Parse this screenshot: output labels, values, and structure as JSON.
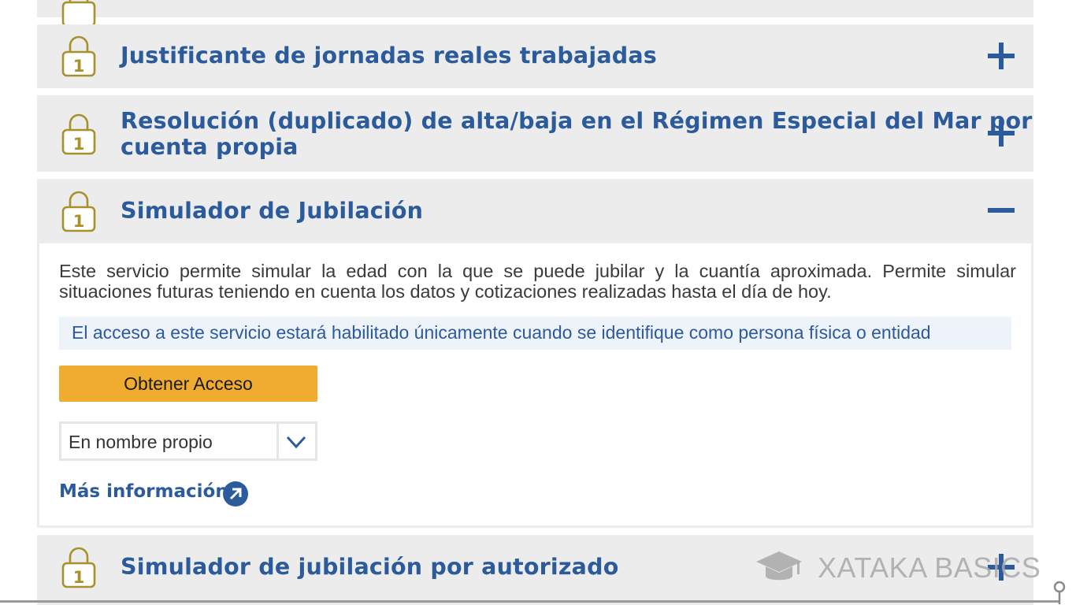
{
  "sections": {
    "jornadas": {
      "title": "Justificante de jornadas reales trabajadas",
      "toggle": "+"
    },
    "resolucion": {
      "title_line1": "Resolución (duplicado) de alta/baja en el Régimen Especial del Mar por",
      "title_line2": "cuenta propia",
      "toggle": "+"
    },
    "simulador": {
      "title": "Simulador de Jubilación",
      "toggle": "−",
      "description": "Este servicio permite simular la edad con la que se puede jubilar y la cuantía aproximada. Permite simular situaciones futuras teniendo en cuenta los datos y cotizaciones realizadas hasta el día de hoy.",
      "notice": "El acceso a este servicio estará habilitado únicamente cuando se identifique como persona física o entidad",
      "access_button": "Obtener Acceso",
      "select_value": "En nombre propio",
      "more_info": "Más información"
    },
    "autorizado": {
      "title": "Simulador de jubilación por autorizado",
      "toggle": "+"
    }
  },
  "lock_number": "1",
  "watermark": "XATAKA BASICS",
  "colors": {
    "title_blue": "#2c5b9b",
    "panel_gray": "#ececec",
    "button_orange": "#efac2f",
    "lock_gold": "#a8902a",
    "notice_bg": "#eef2f9"
  },
  "icons": {
    "lock": "lock-1-icon",
    "expand": "plus-icon",
    "collapse": "minus-icon",
    "dropdown": "chevron-down-icon",
    "external": "arrow-up-right-circle-icon",
    "watermark": "graduation-cap-icon"
  }
}
